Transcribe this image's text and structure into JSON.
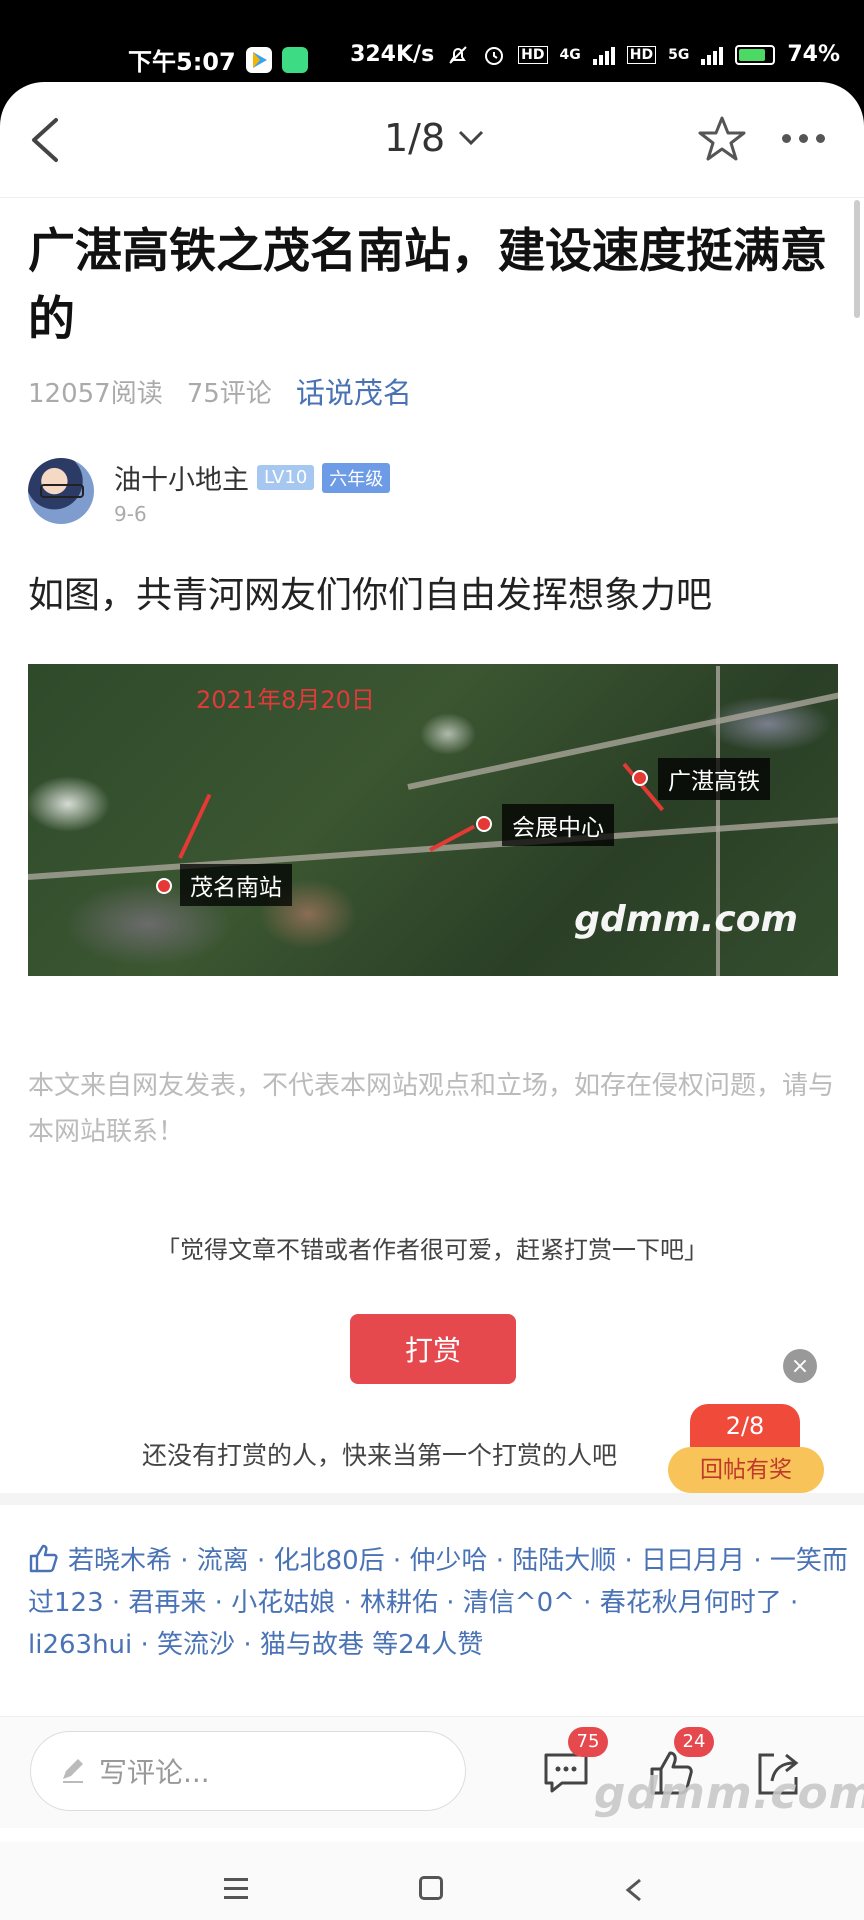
{
  "status_bar": {
    "time": "下午5:07",
    "speed": "324K/s",
    "network_4g": "4G",
    "network_5g": "5G",
    "hd": "HD",
    "battery": "74%"
  },
  "nav": {
    "pager": "1/8"
  },
  "article": {
    "title": "广湛高铁之茂名南站，建设速度挺满意的",
    "reads": "12057阅读",
    "comments": "75评论",
    "topic": "话说茂名",
    "author": {
      "name": "油十小地主",
      "level": "LV10",
      "grade": "六年级",
      "date": "9-6"
    },
    "body": "如图，共青河网友们你们自由发挥想象力吧",
    "image": {
      "date_label": "2021年8月20日",
      "labels": [
        "广湛高铁",
        "会展中心",
        "茂名南站"
      ],
      "markers": [
        "1",
        "2",
        "3"
      ],
      "watermark": "gdmm.com"
    },
    "disclaimer": "本文来自网友发表，不代表本网站观点和立场，如存在侵权问题，请与本网站联系！"
  },
  "reward": {
    "prompt": "「觉得文章不错或者作者很可爱，赶紧打赏一下吧」",
    "button": "打赏",
    "none": "还没有打赏的人，快来当第一个打赏的人吧"
  },
  "float": {
    "close": "×",
    "page": "2/8",
    "cta": "回帖有奖"
  },
  "likes": {
    "text": "若晓木希 · 流离 · 化北80后 · 仲少哈 · 陆陆大顺 · 日曰月月 · 一笑而过123 · 君再来 · 小花姑娘 · 林耕佑 · 清信^0^ · 春花秋月何时了 · li263hui · 笑流沙 · 猫与故巷 等24人赞"
  },
  "comment_bar": {
    "placeholder": "写评论...",
    "comment_count": "75",
    "like_count": "24"
  },
  "watermark": "gdmm.com",
  "colors": {
    "accent": "#e5484d",
    "link": "#4a73b5"
  }
}
